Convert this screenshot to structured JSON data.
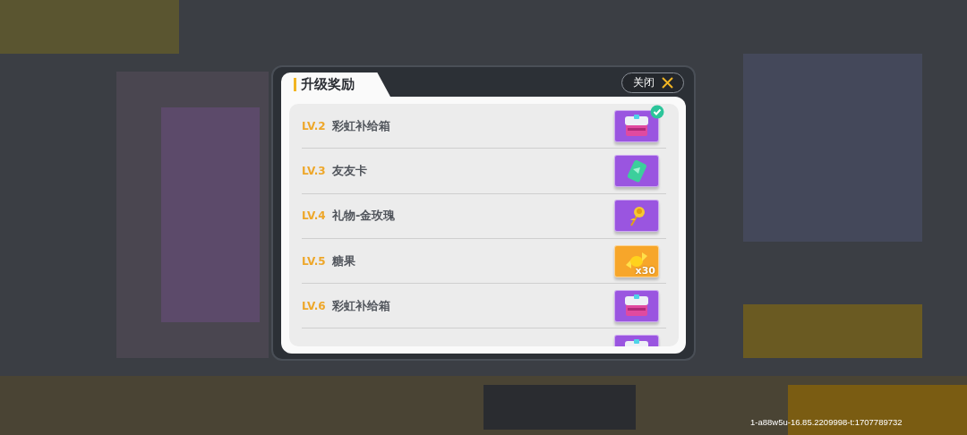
{
  "dialog": {
    "title": "升级奖励",
    "close_button": {
      "label": "关闭"
    },
    "rewards": [
      {
        "level": "LV.2",
        "name": "彩虹补给箱",
        "kind": "chest",
        "color": "#9a55e0",
        "claimed": true
      },
      {
        "level": "LV.3",
        "name": "友友卡",
        "kind": "card",
        "color": "#9a55e0",
        "claimed": false
      },
      {
        "level": "LV.4",
        "name": "礼物-金玫瑰",
        "kind": "rose",
        "color": "#9a55e0",
        "claimed": false
      },
      {
        "level": "LV.5",
        "name": "糖果",
        "kind": "candy",
        "color": "#f7a62a",
        "count": "x30",
        "claimed": false
      },
      {
        "level": "LV.6",
        "name": "彩虹补给箱",
        "kind": "chest",
        "color": "#9a55e0",
        "claimed": false
      },
      {
        "kind": "chest",
        "color": "#9a55e0",
        "claimed": false
      }
    ]
  },
  "build_info": "1-a88w5u-16.85.2209998-t:1707789732"
}
